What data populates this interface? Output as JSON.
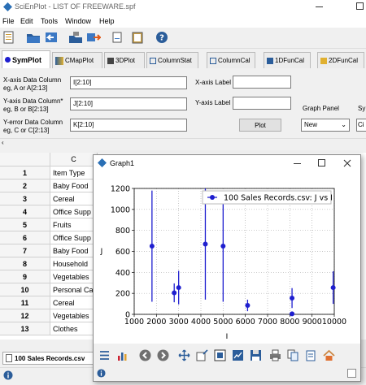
{
  "app": {
    "title": "SciEnPlot - LIST OF FREEWARE.spf",
    "menu": [
      "File",
      "Edit",
      "Tools",
      "Window",
      "Help"
    ]
  },
  "tabs": [
    {
      "label": "SymPlot",
      "active": true
    },
    {
      "label": "CMapPlot"
    },
    {
      "label": "3DPlot"
    },
    {
      "label": "ColumnStat"
    },
    {
      "label": "ColumnCal"
    },
    {
      "label": "1DFunCal"
    },
    {
      "label": "2DFunCal"
    }
  ],
  "form": {
    "x_col_label": "X-axis Data Column",
    "x_col_hint": "eg, A or A[2:13]",
    "x_col_value": "I[2:10]",
    "y_col_label": "Y-axis Data Column*",
    "y_col_hint": "eg, B or B[2:13]",
    "y_col_value": "J[2:10]",
    "yerr_col_label": "Y-error Data Column",
    "yerr_col_hint": "eg, C or C[2:13]",
    "yerr_col_value": "K[2:10]",
    "x_axis_label": "X-axis Label",
    "y_axis_label": "Y-axis Label",
    "x_axis_value": "",
    "y_axis_value": "",
    "graph_panel_label": "Graph Panel",
    "graph_panel_value": "New",
    "sym_label": "Sy",
    "sym_value": "Ci",
    "plot_button": "Plot"
  },
  "grid": {
    "column_header": "C",
    "rows": [
      {
        "n": "1",
        "value": "Item Type"
      },
      {
        "n": "2",
        "value": "Baby Food"
      },
      {
        "n": "3",
        "value": "Cereal"
      },
      {
        "n": "4",
        "value": "Office Supp"
      },
      {
        "n": "5",
        "value": "Fruits"
      },
      {
        "n": "6",
        "value": "Office Supp"
      },
      {
        "n": "7",
        "value": "Baby Food"
      },
      {
        "n": "8",
        "value": "Household"
      },
      {
        "n": "9",
        "value": "Vegetables"
      },
      {
        "n": "10",
        "value": "Personal Ca"
      },
      {
        "n": "11",
        "value": "Cereal"
      },
      {
        "n": "12",
        "value": "Vegetables"
      },
      {
        "n": "13",
        "value": "Clothes"
      }
    ],
    "sheet_tab": "100 Sales Records.csv"
  },
  "graph": {
    "title": "Graph1",
    "colors": {
      "series": "#1f1fcf"
    }
  },
  "chart_data": {
    "type": "scatter",
    "title": "",
    "xlabel": "I",
    "ylabel": "J",
    "xlim": [
      1000,
      10000
    ],
    "ylim": [
      0,
      1200
    ],
    "xticks": [
      "1000",
      "2000",
      "3000",
      "4000",
      "5000",
      "6000",
      "7000",
      "8000",
      "9000",
      "10000"
    ],
    "yticks": [
      "0",
      "200",
      "400",
      "600",
      "800",
      "1000",
      "1200"
    ],
    "grid": true,
    "legend_position": "top-right",
    "series": [
      {
        "name": "100 Sales Records.csv: J vs I",
        "x": [
          1800,
          2800,
          3000,
          4200,
          5000,
          6100,
          8100,
          8100,
          9950
        ],
        "y": [
          650,
          205,
          255,
          670,
          650,
          85,
          155,
          5,
          255
        ],
        "yerr": [
          530,
          90,
          160,
          530,
          530,
          55,
          95,
          3,
          155
        ]
      }
    ]
  }
}
